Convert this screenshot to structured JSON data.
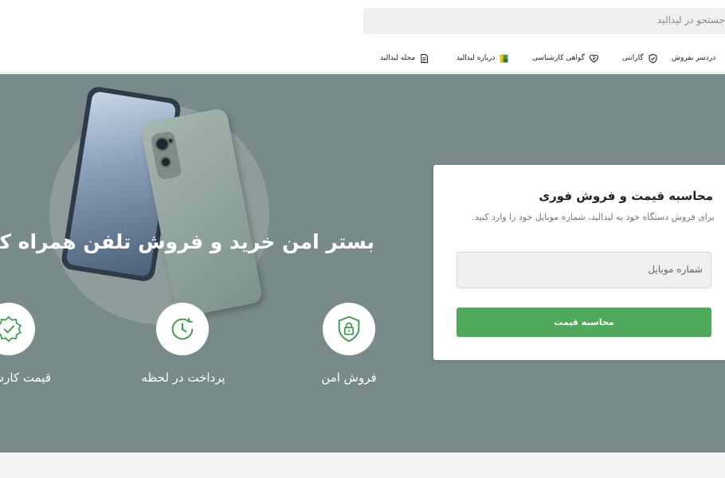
{
  "search": {
    "placeholder": "جستجو در لیدالید"
  },
  "nav": {
    "items": [
      {
        "label": "دردسر بفروش",
        "icon": "sell-icon"
      },
      {
        "label": "گارانتی",
        "icon": "shield-icon"
      },
      {
        "label": "گواهی کارشناسی",
        "icon": "certificate-icon"
      },
      {
        "label": "درباره لیدالید",
        "icon": "brand-logo-icon"
      },
      {
        "label": "مجله لیدالید",
        "icon": "document-icon"
      }
    ]
  },
  "hero": {
    "headline": "بستر امن خرید و فروش تلفن همراه کارکرده",
    "features": [
      {
        "label": "فروش امن",
        "icon": "lock-shield-icon"
      },
      {
        "label": "پرداخت در لحظه",
        "icon": "clock-icon"
      },
      {
        "label": "قیمت کارشناسی",
        "icon": "badge-check-icon"
      }
    ]
  },
  "price_card": {
    "title": "محاسبه قیمت و فروش فوری",
    "description": "برای فروش دستگاه خود به لیدالید، شماره موبایل خود را وارد کنید.",
    "mobile_placeholder": "شماره موبایل",
    "submit_label": "محاسبه قیمت"
  },
  "colors": {
    "hero_bg": "#788a89",
    "accent": "#4ea95a",
    "icon_green": "#3c9a4a"
  }
}
